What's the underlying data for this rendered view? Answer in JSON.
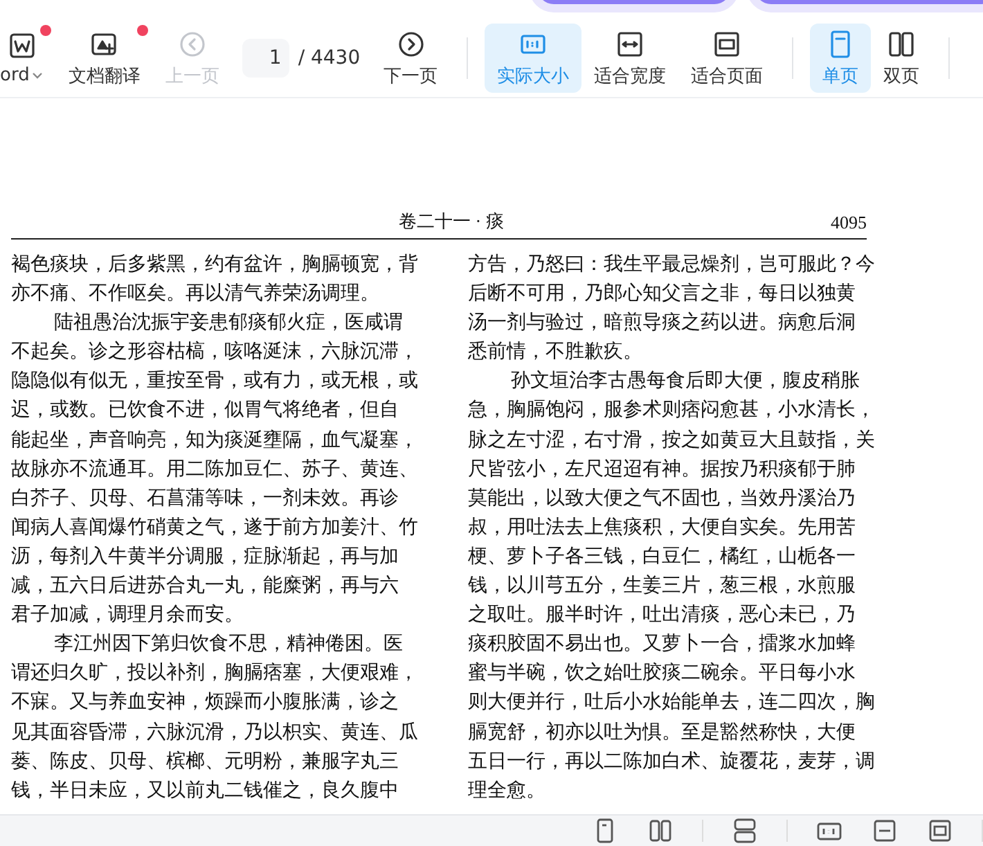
{
  "toolbar": {
    "items": [
      {
        "kind": "dropdown",
        "label": "ord",
        "badge": true,
        "selected": false,
        "disabled": false
      },
      {
        "kind": "button",
        "label": "文档翻译",
        "badge": true,
        "selected": false,
        "disabled": false
      },
      {
        "kind": "button",
        "label": "上一页",
        "badge": false,
        "selected": false,
        "disabled": true
      },
      {
        "kind": "pager",
        "value": "1",
        "total": "/ 4430"
      },
      {
        "kind": "button",
        "label": "下一页",
        "badge": false,
        "selected": false,
        "disabled": false
      },
      {
        "kind": "divider"
      },
      {
        "kind": "button",
        "label": "实际大小",
        "badge": false,
        "selected": true,
        "disabled": false
      },
      {
        "kind": "button",
        "label": "适合宽度",
        "badge": false,
        "selected": false,
        "disabled": false
      },
      {
        "kind": "button",
        "label": "适合页面",
        "badge": false,
        "selected": false,
        "disabled": false
      },
      {
        "kind": "divider"
      },
      {
        "kind": "button",
        "label": "单页",
        "badge": false,
        "selected": true,
        "disabled": false
      },
      {
        "kind": "button",
        "label": "双页",
        "badge": false,
        "selected": false,
        "disabled": false
      },
      {
        "kind": "divider"
      }
    ]
  },
  "page": {
    "running_head": "卷二十一 · 痰",
    "page_number": "4095",
    "columns": [
      {
        "lines": [
          {
            "kind": "cont",
            "text": "褐色痰块，后多紫黑，约有盆许，胸膈顿宽，背"
          },
          {
            "kind": "cont",
            "text": "亦不痛、不作呕矣。再以清气养荣汤调理。"
          },
          {
            "kind": "para",
            "text": "陆祖愚治沈振宇妾患郁痰郁火症，医咸谓"
          },
          {
            "kind": "cont",
            "text": "不起矣。诊之形容枯槁，咳咯涎沫，六脉沉滞，"
          },
          {
            "kind": "cont",
            "text": "隐隐似有似无，重按至骨，或有力，或无根，或"
          },
          {
            "kind": "cont",
            "text": "迟，或数。已饮食不进，似胃气将绝者，但自"
          },
          {
            "kind": "cont",
            "text": "能起坐，声音响亮，知为痰涎壅隔，血气凝塞，"
          },
          {
            "kind": "cont",
            "text": "故脉亦不流通耳。用二陈加豆仁、苏子、黄连、"
          },
          {
            "kind": "cont",
            "text": "白芥子、贝母、石菖蒲等味，一剂未效。再诊"
          },
          {
            "kind": "cont",
            "text": "闻病人喜闻爆竹硝黄之气，遂于前方加姜汁、竹"
          },
          {
            "kind": "cont",
            "text": "沥，每剂入牛黄半分调服，症脉渐起，再与加"
          },
          {
            "kind": "cont",
            "text": "减，五六日后进苏合丸一丸，能糜粥，再与六"
          },
          {
            "kind": "cont",
            "text": "君子加减，调理月余而安。"
          },
          {
            "kind": "para",
            "text": "李江州因下第归饮食不思，精神倦困。医"
          },
          {
            "kind": "cont",
            "text": "谓还归久旷，投以补剂，胸膈痞塞，大便艰难，"
          },
          {
            "kind": "cont",
            "text": "不寐。又与养血安神，烦躁而小腹胀满，诊之"
          },
          {
            "kind": "cont",
            "text": "见其面容昏滞，六脉沉滑，乃以枳实、黄连、瓜"
          },
          {
            "kind": "cont",
            "text": "蒌、陈皮、贝母、槟榔、元明粉，兼服字丸三"
          },
          {
            "kind": "cont",
            "text": "钱，半日未应，又以前丸二钱催之，良久腹中"
          }
        ]
      },
      {
        "lines": [
          {
            "kind": "cont",
            "text": "方告，乃怒曰：我生平最忌燥剂，岂可服此？今"
          },
          {
            "kind": "cont",
            "text": "后断不可用，乃郎心知父言之非，每日以独黄"
          },
          {
            "kind": "cont",
            "text": "汤一剂与验过，暗煎导痰之药以进。病愈后洞"
          },
          {
            "kind": "cont",
            "text": "悉前情，不胜歉疚。"
          },
          {
            "kind": "para",
            "text": "孙文垣治李古愚每食后即大便，腹皮稍胀"
          },
          {
            "kind": "cont",
            "text": "急，胸膈饱闷，服参术则痞闷愈甚，小水清长，"
          },
          {
            "kind": "cont",
            "text": "脉之左寸涩，右寸滑，按之如黄豆大且鼓指，关"
          },
          {
            "kind": "cont",
            "text": "尺皆弦小，左尺迢迢有神。据按乃积痰郁于肺"
          },
          {
            "kind": "cont",
            "text": "莫能出，以致大便之气不固也，当效丹溪治乃"
          },
          {
            "kind": "cont",
            "text": "叔，用吐法去上焦痰积，大便自实矣。先用苦"
          },
          {
            "kind": "cont",
            "text": "梗、萝卜子各三钱，白豆仁，橘红，山栀各一"
          },
          {
            "kind": "cont",
            "text": "钱，以川芎五分，生姜三片，葱三根，水煎服"
          },
          {
            "kind": "cont",
            "text": "之取吐。服半时许，吐出清痰，恶心未已，乃"
          },
          {
            "kind": "cont",
            "text": "痰积胶固不易出也。又萝卜一合，擂浆水加蜂"
          },
          {
            "kind": "cont",
            "text": "蜜与半碗，饮之始吐胶痰二碗余。平日每小水"
          },
          {
            "kind": "cont",
            "text": "则大便并行，吐后小水始能单去，连二四次，胸"
          },
          {
            "kind": "cont",
            "text": "膈宽舒，初亦以吐为惧。至是豁然称快，大便"
          },
          {
            "kind": "cont",
            "text": "五日一行，再以二陈加白术、旋覆花，麦芽，调"
          },
          {
            "kind": "cont",
            "text": "理全愈。"
          }
        ]
      }
    ]
  }
}
